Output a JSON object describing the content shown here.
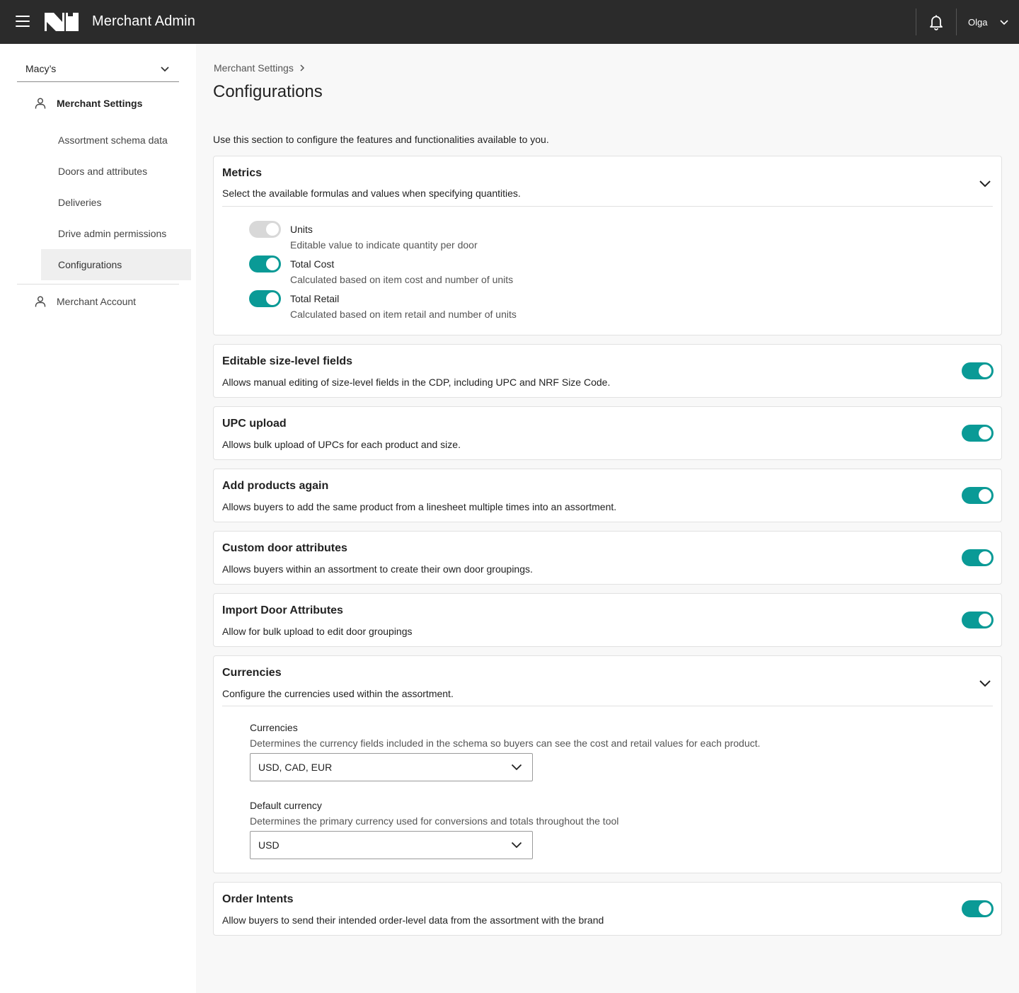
{
  "header": {
    "app_title": "Merchant Admin",
    "user_name": "Olga"
  },
  "sidebar": {
    "merchant": "Macy’s",
    "section_settings": "Merchant Settings",
    "items": [
      {
        "label": "Assortment schema data"
      },
      {
        "label": "Doors and attributes"
      },
      {
        "label": "Deliveries"
      },
      {
        "label": "Drive admin permissions"
      },
      {
        "label": "Configurations"
      }
    ],
    "section_account": "Merchant Account"
  },
  "page": {
    "breadcrumb": "Merchant Settings",
    "title": "Configurations",
    "intro": "Use this section to configure the features and functionalities available to you."
  },
  "metrics": {
    "title": "Metrics",
    "desc": "Select the available formulas and values when specifying quantities.",
    "options": [
      {
        "name": "Units",
        "desc": "Editable value to indicate quantity per door",
        "enabled": false
      },
      {
        "name": "Total Cost",
        "desc": "Calculated based on item cost and number of units",
        "enabled": true
      },
      {
        "name": "Total Retail",
        "desc": "Calculated based on item retail and number of units",
        "enabled": true
      }
    ]
  },
  "features": [
    {
      "title": "Editable size-level fields",
      "desc": "Allows manual editing of size-level fields in the CDP, including UPC and NRF Size Code.",
      "enabled": true
    },
    {
      "title": "UPC upload",
      "desc": "Allows bulk upload of UPCs for each product and size.",
      "enabled": true
    },
    {
      "title": "Add products again",
      "desc": "Allows buyers to add the same product from a linesheet multiple times into an assortment.",
      "enabled": true
    },
    {
      "title": "Custom door attributes",
      "desc": "Allows buyers within an assortment to create their own door groupings.",
      "enabled": true
    },
    {
      "title": "Import Door Attributes",
      "desc": "Allow for bulk upload to edit door groupings",
      "enabled": true
    }
  ],
  "currencies": {
    "title": "Currencies",
    "desc": "Configure the currencies used within the assortment.",
    "currencies_label": "Currencies",
    "currencies_desc": "Determines the currency fields included in the schema so buyers can see the cost and retail values for each product.",
    "currencies_value": "USD, CAD, EUR",
    "default_label": "Default currency",
    "default_desc": "Determines the primary currency used for conversions and totals throughout the tool",
    "default_value": "USD"
  },
  "order_intents": {
    "title": "Order Intents",
    "desc": "Allow buyers to send their intended order-level data from the assortment with the brand",
    "enabled": true
  },
  "colors": {
    "accent": "#0a9a96",
    "topbar": "#2b2b2b",
    "toggle_off": "#d8d8d8"
  }
}
